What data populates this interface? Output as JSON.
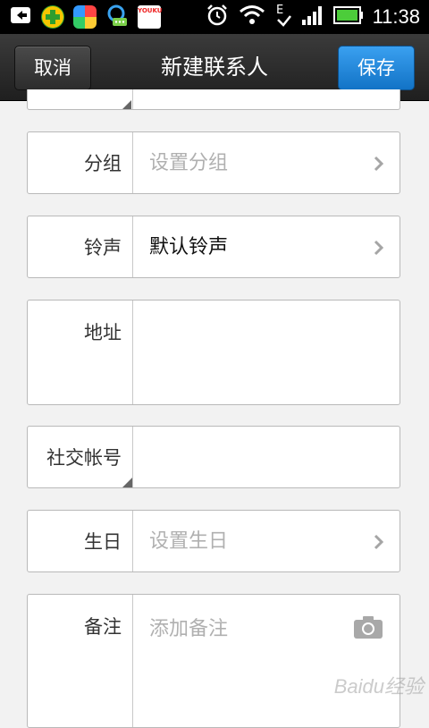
{
  "status_bar": {
    "time": "11:38",
    "icons": [
      "back-arrow-icon",
      "app-plus-icon",
      "app-colorful-icon",
      "qq-icon",
      "youku-icon",
      "alarm-icon",
      "wifi-icon",
      "edge-icon",
      "signal-icon",
      "battery-icon"
    ],
    "youku_label": "YOUKU"
  },
  "action_bar": {
    "cancel_label": "取消",
    "title": "新建联系人",
    "save_label": "保存",
    "save_color": "#1e7fd6"
  },
  "form": {
    "group": {
      "label": "分组",
      "placeholder": "设置分组"
    },
    "ringtone": {
      "label": "铃声",
      "value": "默认铃声"
    },
    "address": {
      "label": "地址",
      "value": ""
    },
    "social": {
      "label": "社交帐号",
      "value": ""
    },
    "birthday": {
      "label": "生日",
      "placeholder": "设置生日"
    },
    "notes": {
      "label": "备注",
      "placeholder": "添加备注"
    }
  },
  "watermark": "Baidu经验"
}
